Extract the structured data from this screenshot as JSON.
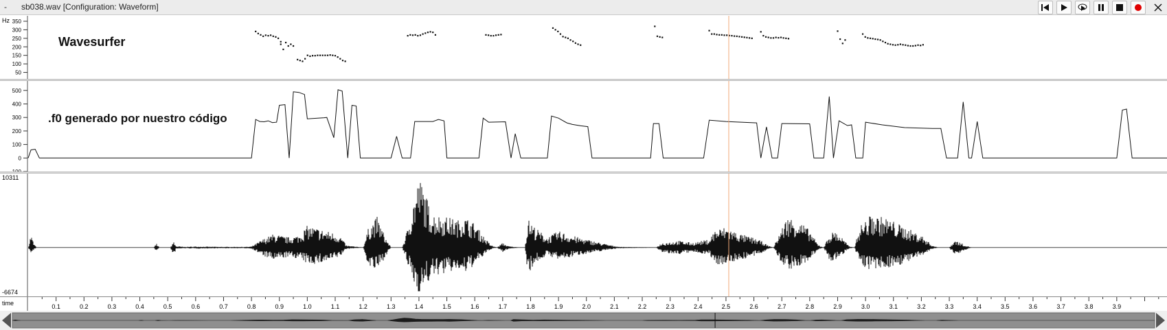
{
  "window": {
    "title": "sb038.wav  [Configuration: Waveform]",
    "menu_glyph": "-"
  },
  "toolbar": {
    "buttons": [
      "skip-to-start-icon",
      "play-icon",
      "play-loop-icon",
      "pause-icon",
      "stop-icon",
      "record-icon",
      "close-icon"
    ],
    "record_color": "#e00000"
  },
  "colors": {
    "cursor": "#f0a878",
    "trace": "#111111"
  },
  "cursor_time": 2.51,
  "pitch_pane": {
    "label": "Wavesurfer",
    "unit": "Hz",
    "ticks": [
      "350",
      "300",
      "250",
      "200",
      "150",
      "100",
      "50"
    ],
    "chart_data": {
      "type": "scatter",
      "xlim": [
        0,
        4.08
      ],
      "ylim": [
        20,
        370
      ],
      "segments": [
        {
          "t0": 0.815,
          "dt": 0.009,
          "hz": [
            290,
            278,
            270,
            262,
            268,
            265,
            268,
            262,
            258,
            250,
            230
          ]
        },
        {
          "t0": 0.905,
          "dt": 0.009,
          "hz": [
            215,
            185,
            225,
            205,
            215,
            205
          ]
        },
        {
          "t0": 0.965,
          "dt": 0.009,
          "hz": [
            125,
            120,
            115,
            130,
            150,
            145,
            148,
            148,
            150,
            150,
            150,
            150,
            150,
            152,
            150,
            148,
            140,
            130,
            120,
            115
          ]
        },
        {
          "t0": 1.36,
          "dt": 0.009,
          "hz": [
            265,
            270,
            268,
            270,
            265,
            268,
            275,
            280,
            285,
            288,
            285,
            270
          ]
        },
        {
          "t0": 1.64,
          "dt": 0.009,
          "hz": [
            270,
            268,
            265,
            265,
            268,
            270,
            272
          ]
        },
        {
          "t0": 1.88,
          "dt": 0.009,
          "hz": [
            310,
            300,
            290,
            275,
            260,
            255,
            250,
            240,
            232,
            222,
            215,
            210
          ]
        },
        {
          "t0": 2.245,
          "dt": 0.009,
          "hz": [
            320,
            262,
            258,
            255
          ]
        },
        {
          "t0": 2.44,
          "dt": 0.009,
          "hz": [
            295,
            275,
            275,
            272,
            270,
            270,
            268,
            268,
            266,
            265,
            263,
            262,
            260,
            258,
            256,
            254,
            252,
            250
          ]
        },
        {
          "t0": 2.625,
          "dt": 0.009,
          "hz": [
            288,
            265,
            258,
            255,
            252,
            252,
            255,
            253,
            255,
            252,
            250,
            248
          ]
        },
        {
          "t0": 2.9,
          "dt": 0.009,
          "hz": [
            292,
            245,
            220,
            240
          ]
        },
        {
          "t0": 2.99,
          "dt": 0.009,
          "hz": [
            275,
            258,
            252,
            250,
            248,
            245,
            243,
            240,
            232,
            225,
            218,
            215,
            212,
            210,
            212,
            215,
            212,
            210,
            207,
            205,
            205,
            207,
            210,
            208,
            212
          ]
        }
      ]
    }
  },
  "f0_pane": {
    "label": ".f0 generado por nuestro código",
    "ticks": [
      "500",
      "400",
      "300",
      "200",
      "100",
      "0",
      "-100"
    ],
    "chart_data": {
      "type": "line",
      "xlim": [
        0,
        4.08
      ],
      "ylim": [
        -100,
        570
      ],
      "points": [
        [
          0,
          0
        ],
        [
          0.01,
          60
        ],
        [
          0.025,
          65
        ],
        [
          0.04,
          0
        ],
        [
          0.8,
          0
        ],
        [
          0.815,
          285
        ],
        [
          0.83,
          270
        ],
        [
          0.845,
          268
        ],
        [
          0.86,
          275
        ],
        [
          0.875,
          262
        ],
        [
          0.89,
          265
        ],
        [
          0.9,
          390
        ],
        [
          0.92,
          395
        ],
        [
          0.935,
          0
        ],
        [
          0.95,
          490
        ],
        [
          0.97,
          485
        ],
        [
          0.99,
          470
        ],
        [
          1.0,
          290
        ],
        [
          1.06,
          298
        ],
        [
          1.07,
          300
        ],
        [
          1.095,
          150
        ],
        [
          1.11,
          505
        ],
        [
          1.125,
          495
        ],
        [
          1.145,
          0
        ],
        [
          1.16,
          390
        ],
        [
          1.175,
          385
        ],
        [
          1.19,
          0
        ],
        [
          1.3,
          0
        ],
        [
          1.32,
          160
        ],
        [
          1.34,
          0
        ],
        [
          1.37,
          0
        ],
        [
          1.385,
          270
        ],
        [
          1.45,
          270
        ],
        [
          1.47,
          285
        ],
        [
          1.49,
          275
        ],
        [
          1.5,
          0
        ],
        [
          1.615,
          0
        ],
        [
          1.63,
          295
        ],
        [
          1.65,
          265
        ],
        [
          1.71,
          268
        ],
        [
          1.73,
          0
        ],
        [
          1.745,
          180
        ],
        [
          1.765,
          0
        ],
        [
          1.86,
          0
        ],
        [
          1.875,
          310
        ],
        [
          1.9,
          295
        ],
        [
          1.93,
          260
        ],
        [
          1.95,
          248
        ],
        [
          1.98,
          238
        ],
        [
          2.005,
          232
        ],
        [
          2.02,
          0
        ],
        [
          2.23,
          0
        ],
        [
          2.24,
          255
        ],
        [
          2.26,
          255
        ],
        [
          2.275,
          0
        ],
        [
          2.42,
          0
        ],
        [
          2.44,
          280
        ],
        [
          2.5,
          270
        ],
        [
          2.61,
          260
        ],
        [
          2.625,
          0
        ],
        [
          2.645,
          230
        ],
        [
          2.665,
          0
        ],
        [
          2.685,
          0
        ],
        [
          2.7,
          255
        ],
        [
          2.8,
          253
        ],
        [
          2.815,
          0
        ],
        [
          2.85,
          0
        ],
        [
          2.87,
          455
        ],
        [
          2.885,
          0
        ],
        [
          2.905,
          275
        ],
        [
          2.935,
          240
        ],
        [
          2.95,
          245
        ],
        [
          2.965,
          0
        ],
        [
          2.99,
          0
        ],
        [
          3.0,
          265
        ],
        [
          3.06,
          245
        ],
        [
          3.14,
          225
        ],
        [
          3.24,
          218
        ],
        [
          3.27,
          218
        ],
        [
          3.29,
          0
        ],
        [
          3.33,
          0
        ],
        [
          3.35,
          415
        ],
        [
          3.37,
          0
        ],
        [
          3.38,
          0
        ],
        [
          3.4,
          270
        ],
        [
          3.42,
          0
        ],
        [
          3.9,
          0
        ],
        [
          3.92,
          355
        ],
        [
          3.935,
          362
        ],
        [
          3.955,
          0
        ],
        [
          4.08,
          0
        ]
      ]
    }
  },
  "wave_pane": {
    "max_label": "10311",
    "min_label": "-6674",
    "chart_data": {
      "type": "area",
      "xlim": [
        0,
        4.08
      ],
      "ylim": [
        -6674,
        10311
      ],
      "envelope": [
        [
          0.0,
          0,
          0
        ],
        [
          0.01,
          2000,
          -800
        ],
        [
          0.02,
          600,
          -400
        ],
        [
          0.03,
          0,
          0
        ],
        [
          0.45,
          0,
          0
        ],
        [
          0.46,
          600,
          -600
        ],
        [
          0.47,
          0,
          0
        ],
        [
          0.51,
          0,
          0
        ],
        [
          0.52,
          900,
          -1400
        ],
        [
          0.53,
          200,
          -200
        ],
        [
          0.56,
          100,
          -100
        ],
        [
          0.6,
          150,
          -150
        ],
        [
          0.7,
          100,
          -100
        ],
        [
          0.78,
          100,
          -100
        ],
        [
          0.8,
          150,
          -150
        ],
        [
          0.84,
          1200,
          -1200
        ],
        [
          0.88,
          2000,
          -1900
        ],
        [
          0.93,
          1500,
          -1400
        ],
        [
          0.97,
          1800,
          -1600
        ],
        [
          1.0,
          3200,
          -2400
        ],
        [
          1.04,
          2800,
          -2400
        ],
        [
          1.07,
          2400,
          -2100
        ],
        [
          1.1,
          2100,
          -1700
        ],
        [
          1.12,
          1600,
          -1200
        ],
        [
          1.14,
          300,
          -200
        ],
        [
          1.2,
          0,
          0
        ],
        [
          1.22,
          3000,
          -2800
        ],
        [
          1.25,
          4500,
          -3500
        ],
        [
          1.28,
          1500,
          -1300
        ],
        [
          1.3,
          0,
          0
        ],
        [
          1.34,
          0,
          0
        ],
        [
          1.36,
          2800,
          -2600
        ],
        [
          1.38,
          6800,
          -5200
        ],
        [
          1.4,
          10300,
          -6600
        ],
        [
          1.42,
          8500,
          -5800
        ],
        [
          1.44,
          5500,
          -4800
        ],
        [
          1.46,
          4800,
          -4000
        ],
        [
          1.5,
          4500,
          -3800
        ],
        [
          1.54,
          4000,
          -3200
        ],
        [
          1.56,
          4600,
          -4000
        ],
        [
          1.6,
          3500,
          -2500
        ],
        [
          1.64,
          1200,
          -900
        ],
        [
          1.66,
          300,
          -200
        ],
        [
          1.68,
          0,
          0
        ],
        [
          1.7,
          700,
          -700
        ],
        [
          1.72,
          200,
          -200
        ],
        [
          1.76,
          0,
          0
        ],
        [
          1.78,
          0,
          0
        ],
        [
          1.79,
          4200,
          -3800
        ],
        [
          1.82,
          2800,
          -2200
        ],
        [
          1.86,
          1500,
          -1100
        ],
        [
          1.9,
          2400,
          -1800
        ],
        [
          1.93,
          2000,
          -1600
        ],
        [
          1.97,
          1500,
          -1100
        ],
        [
          2.02,
          1000,
          -800
        ],
        [
          2.08,
          400,
          -300
        ],
        [
          2.12,
          100,
          -100
        ],
        [
          2.25,
          0,
          0
        ],
        [
          2.27,
          700,
          -800
        ],
        [
          2.33,
          1000,
          -1000
        ],
        [
          2.38,
          700,
          -700
        ],
        [
          2.44,
          1200,
          -1000
        ],
        [
          2.46,
          2600,
          -2500
        ],
        [
          2.5,
          3000,
          -2400
        ],
        [
          2.55,
          2000,
          -1800
        ],
        [
          2.6,
          1400,
          -1300
        ],
        [
          2.63,
          900,
          -800
        ],
        [
          2.65,
          300,
          -200
        ],
        [
          2.67,
          0,
          0
        ],
        [
          2.69,
          2000,
          -1800
        ],
        [
          2.72,
          4500,
          -3200
        ],
        [
          2.76,
          4000,
          -3000
        ],
        [
          2.8,
          2500,
          -1800
        ],
        [
          2.83,
          400,
          -300
        ],
        [
          2.85,
          0,
          0
        ],
        [
          2.87,
          1800,
          -2100
        ],
        [
          2.89,
          2500,
          -1900
        ],
        [
          2.92,
          1300,
          -900
        ],
        [
          2.94,
          200,
          -200
        ],
        [
          2.96,
          0,
          0
        ],
        [
          2.98,
          3200,
          -2500
        ],
        [
          3.02,
          4800,
          -3400
        ],
        [
          3.08,
          4300,
          -3000
        ],
        [
          3.14,
          3000,
          -2300
        ],
        [
          3.2,
          1800,
          -1300
        ],
        [
          3.24,
          300,
          -200
        ],
        [
          3.26,
          0,
          0
        ],
        [
          3.3,
          0,
          0
        ],
        [
          3.32,
          1100,
          -1200
        ],
        [
          3.36,
          300,
          -300
        ],
        [
          3.38,
          0,
          0
        ],
        [
          4.08,
          0,
          0
        ]
      ]
    }
  },
  "time_axis": {
    "label": "time",
    "ticks": [
      "0.1",
      "0.2",
      "0.3",
      "0.4",
      "0.5",
      "0.6",
      "0.7",
      "0.8",
      "0.9",
      "1.0",
      "1.1",
      "1.2",
      "1.3",
      "1.4",
      "1.5",
      "1.6",
      "1.7",
      "1.8",
      "1.9",
      "2.0",
      "2.1",
      "2.2",
      "2.3",
      "2.4",
      "2.5",
      "2.6",
      "2.7",
      "2.8",
      "2.9",
      "3.0",
      "3.1",
      "3.2",
      "3.3",
      "3.4",
      "3.5",
      "3.6",
      "3.7",
      "3.8",
      "3.9"
    ]
  },
  "scrollbar": {
    "thumb_start": 0,
    "thumb_end": 1
  }
}
